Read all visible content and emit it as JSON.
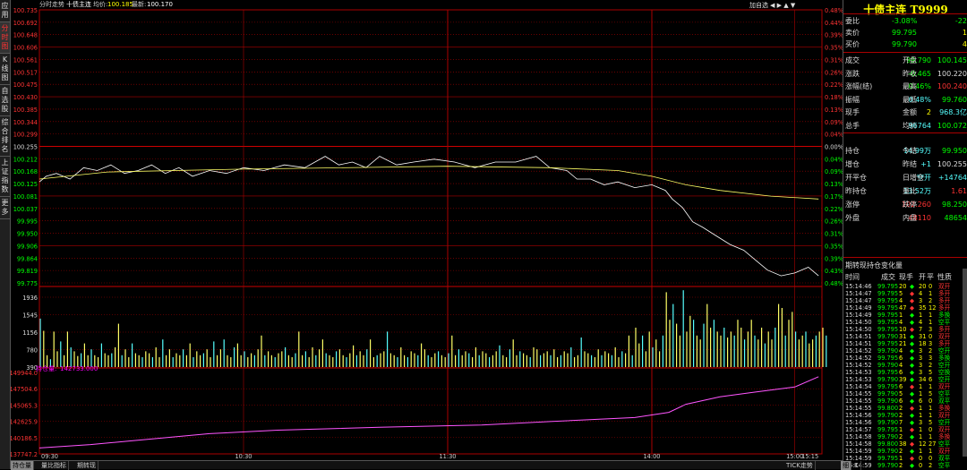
{
  "tabs": [
    "应用",
    "分时图",
    "K线图",
    "自选股",
    "综合排名",
    "上证指数",
    "更多"
  ],
  "header": {
    "title": "分时走势",
    "instrument": "十债主连",
    "avg_label": "均价:",
    "avg": "100.185",
    "last_label": "最新:",
    "last": "100.170",
    "add_self": "加自选"
  },
  "axis": {
    "price": [
      "100.735",
      "100.692",
      "100.648",
      "100.606",
      "100.561",
      "100.517",
      "100.475",
      "100.430",
      "100.385",
      "100.344",
      "100.299",
      "100.255",
      "100.212",
      "100.168",
      "100.125",
      "100.081",
      "100.037",
      "99.995",
      "99.950",
      "99.906",
      "99.864",
      "99.819",
      "99.775"
    ],
    "pct": [
      "0.48%",
      "0.44%",
      "0.39%",
      "0.35%",
      "0.31%",
      "0.26%",
      "0.22%",
      "0.18%",
      "0.13%",
      "0.09%",
      "0.04%",
      "0.00%",
      "0.04%",
      "0.09%",
      "0.13%",
      "0.17%",
      "0.22%",
      "0.26%",
      "0.31%",
      "0.35%",
      "0.39%",
      "0.43%",
      "0.48%"
    ],
    "vol": [
      "1936",
      "1545",
      "1156",
      "780",
      "390"
    ],
    "oi": [
      "149944.0",
      "147504.6",
      "145065.3",
      "142625.9",
      "140186.5",
      "137747.2"
    ],
    "time": [
      "09:30",
      "10:30",
      "11:30",
      "14:00",
      "15:00",
      "15:15"
    ]
  },
  "oi_label": "持仓量:",
  "oi_value": "142733.000",
  "chart_data": {
    "type": "line",
    "x_start": "09:30",
    "x_end": "15:15",
    "prev_close": 100.255,
    "ylim": [
      99.775,
      100.735
    ],
    "price_points": [
      [
        0,
        100.13
      ],
      [
        2,
        100.15
      ],
      [
        5,
        100.16
      ],
      [
        9,
        100.14
      ],
      [
        13,
        100.18
      ],
      [
        17,
        100.17
      ],
      [
        21,
        100.19
      ],
      [
        25,
        100.16
      ],
      [
        29,
        100.17
      ],
      [
        33,
        100.19
      ],
      [
        37,
        100.16
      ],
      [
        41,
        100.18
      ],
      [
        45,
        100.15
      ],
      [
        50,
        100.17
      ],
      [
        55,
        100.16
      ],
      [
        60,
        100.18
      ],
      [
        66,
        100.17
      ],
      [
        72,
        100.19
      ],
      [
        78,
        100.18
      ],
      [
        84,
        100.22
      ],
      [
        88,
        100.19
      ],
      [
        92,
        100.2
      ],
      [
        96,
        100.18
      ],
      [
        100,
        100.22
      ],
      [
        105,
        100.19
      ],
      [
        110,
        100.2
      ],
      [
        116,
        100.21
      ],
      [
        122,
        100.2
      ],
      [
        128,
        100.18
      ],
      [
        134,
        100.2
      ],
      [
        140,
        100.2
      ],
      [
        146,
        100.22
      ],
      [
        150,
        100.18
      ],
      [
        155,
        100.17
      ],
      [
        158,
        100.14
      ],
      [
        162,
        100.14
      ],
      [
        166,
        100.12
      ],
      [
        170,
        100.13
      ],
      [
        175,
        100.11
      ],
      [
        180,
        100.12
      ],
      [
        184,
        100.1
      ],
      [
        186,
        100.07
      ],
      [
        189,
        100.04
      ],
      [
        192,
        99.99
      ],
      [
        195,
        99.97
      ],
      [
        199,
        99.94
      ],
      [
        203,
        99.91
      ],
      [
        207,
        99.89
      ],
      [
        211,
        99.85
      ],
      [
        214,
        99.82
      ],
      [
        218,
        99.8
      ],
      [
        222,
        99.81
      ],
      [
        226,
        99.83
      ],
      [
        229,
        99.8
      ]
    ],
    "avg_points": [
      [
        0,
        100.14
      ],
      [
        20,
        100.165
      ],
      [
        60,
        100.175
      ],
      [
        120,
        100.185
      ],
      [
        150,
        100.18
      ],
      [
        170,
        100.17
      ],
      [
        180,
        100.15
      ],
      [
        190,
        100.12
      ],
      [
        200,
        100.1
      ],
      [
        215,
        100.08
      ],
      [
        229,
        100.07
      ]
    ],
    "volume": [
      1230,
      920,
      300,
      200,
      900,
      400,
      650,
      300,
      900,
      500,
      400,
      280,
      350,
      600,
      300,
      450,
      300,
      250,
      600,
      350,
      300,
      350,
      500,
      1100,
      300,
      450,
      250,
      600,
      350,
      300,
      250,
      400,
      350,
      250,
      500,
      250,
      700,
      300,
      450,
      250,
      350,
      300,
      450,
      300,
      600,
      250,
      400,
      300,
      350,
      450,
      250,
      650,
      300,
      450,
      700,
      300,
      250,
      500,
      600,
      300,
      400,
      250,
      350,
      300,
      450,
      800,
      300,
      400,
      300,
      250,
      350,
      400,
      500,
      300,
      250,
      350,
      900,
      300,
      400,
      250,
      500,
      300,
      450,
      700,
      350,
      300,
      250,
      400,
      450,
      300,
      250,
      350,
      550,
      300,
      400,
      300,
      450,
      700,
      250,
      300,
      350,
      400,
      900,
      350,
      300,
      250,
      500,
      300,
      250,
      400,
      350,
      300,
      600,
      450,
      300,
      250,
      350,
      400,
      300,
      250,
      350,
      800,
      300,
      450,
      300,
      400,
      350,
      250,
      500,
      300,
      400,
      350,
      250,
      300,
      400,
      550,
      300,
      250,
      450,
      700,
      300,
      400,
      350,
      300,
      250,
      500,
      450,
      300,
      350,
      400,
      300,
      450,
      250,
      300,
      400,
      350,
      500,
      250,
      300,
      750,
      400,
      350,
      300,
      250,
      450,
      300,
      400,
      350,
      300,
      500,
      250,
      400,
      350,
      800,
      300,
      1000,
      600,
      800,
      400,
      900,
      500,
      700,
      400,
      800,
      1900,
      1200,
      1600,
      1100,
      800,
      1950,
      900,
      1300,
      1200,
      800,
      700,
      1100,
      1600,
      1000,
      1200,
      900,
      800,
      1000,
      750,
      900,
      800,
      1200,
      1000,
      700,
      900,
      1200,
      800,
      700,
      1000,
      600,
      900,
      700,
      1000,
      1600,
      1500,
      800,
      1200,
      1400,
      900,
      700,
      800,
      900,
      600,
      700,
      800,
      900,
      1000,
      800
    ],
    "oi": [
      [
        0,
        136900
      ],
      [
        15,
        137500
      ],
      [
        30,
        138300
      ],
      [
        50,
        139400
      ],
      [
        70,
        140000
      ],
      [
        100,
        140500
      ],
      [
        130,
        140900
      ],
      [
        150,
        141500
      ],
      [
        175,
        142200
      ],
      [
        185,
        143100
      ],
      [
        190,
        144500
      ],
      [
        200,
        145800
      ],
      [
        210,
        146600
      ],
      [
        222,
        147500
      ],
      [
        229,
        149300
      ]
    ]
  },
  "panel": {
    "name": "十债主连",
    "code": "T9999",
    "rows": [
      {
        "l": "委比",
        "v1": "-3.08%",
        "c1": "g",
        "v2": "-22",
        "c2": "g"
      },
      {
        "l": "卖价",
        "v1": "99.795",
        "c1": "g",
        "v2": "1",
        "c2": "y"
      },
      {
        "l": "买价",
        "v1": "99.790",
        "c1": "g",
        "v2": "4",
        "c2": "y"
      }
    ],
    "quote": [
      {
        "l": "成交",
        "v1": "99.790",
        "c1": "g",
        "m": "开盘",
        "v2": "100.145",
        "c2": "g"
      },
      {
        "l": "涨跌",
        "v1": "-0.465",
        "c1": "g",
        "m": "昨收",
        "v2": "100.220",
        "c2": "w"
      },
      {
        "l": "涨幅(结)",
        "v1": "-0.46%",
        "c1": "g",
        "m": "最高",
        "v2": "100.240",
        "c2": "r"
      },
      {
        "l": "振幅",
        "v1": "0.48%",
        "c1": "c",
        "m": "最低",
        "v2": "99.760",
        "c2": "g"
      },
      {
        "l": "现手",
        "v1": "2",
        "c1": "y",
        "m": "金额",
        "v2": "968.3亿",
        "c2": "c"
      },
      {
        "l": "总手",
        "v1": "96764",
        "c1": "c",
        "m": "均价",
        "v2": "100.072",
        "c2": "g"
      }
    ],
    "quote2": [
      {
        "l": "持仓",
        "v1": "14.99万",
        "c1": "c",
        "m": "今结",
        "v2": "99.950",
        "c2": "g"
      },
      {
        "l": "增仓",
        "v1": "+1",
        "c1": "c",
        "m": "昨结",
        "v2": "100.255",
        "c2": "w"
      },
      {
        "l": "开平仓",
        "v1": "空开",
        "c1": "c",
        "m": "日增仓",
        "v2": "+14764",
        "c2": "c"
      },
      {
        "l": "昨持仓",
        "v1": "13.52万",
        "c1": "c",
        "m": "量比",
        "v2": "1.61",
        "c2": "r"
      },
      {
        "l": "涨停",
        "v1": "102.260",
        "c1": "r",
        "m": "跌停",
        "v2": "98.250",
        "c2": "g"
      },
      {
        "l": "外盘",
        "v1": "48110",
        "c1": "r",
        "m": "内盘",
        "v2": "48654",
        "c2": "g"
      }
    ],
    "ticks_title": "期转现持仓变化量",
    "tick_headers": [
      "时间",
      "成交",
      "现手",
      "开",
      "平",
      "性质"
    ],
    "ticks": [
      [
        "15:14:46",
        "99.795",
        "20",
        "g",
        "20",
        "0",
        "双开",
        "r"
      ],
      [
        "15:14:47",
        "99.795",
        "5",
        "r",
        "4",
        "1",
        "多开",
        "r"
      ],
      [
        "15:14:47",
        "99.795",
        "4",
        "r",
        "3",
        "2",
        "多开",
        "r"
      ],
      [
        "15:14:49",
        "99.795",
        "47",
        "r",
        "35",
        "12",
        "多开",
        "r"
      ],
      [
        "15:14:49",
        "99.795",
        "1",
        "g",
        "1",
        "1",
        "多换",
        "g"
      ],
      [
        "15:14:50",
        "99.795",
        "4",
        "g",
        "4",
        "1",
        "空平",
        "g"
      ],
      [
        "15:14:50",
        "99.795",
        "10",
        "r",
        "7",
        "3",
        "多开",
        "r"
      ],
      [
        "15:14:51",
        "99.790",
        "31",
        "g",
        "31",
        "0",
        "双开",
        "r"
      ],
      [
        "15:14:51",
        "99.795",
        "21",
        "g",
        "18",
        "3",
        "多开",
        "r"
      ],
      [
        "15:14:52",
        "99.790",
        "4",
        "g",
        "3",
        "2",
        "空开",
        "g"
      ],
      [
        "15:14:52",
        "99.795",
        "6",
        "g",
        "3",
        "3",
        "多换",
        "g"
      ],
      [
        "15:14:52",
        "99.790",
        "4",
        "g",
        "3",
        "2",
        "空开",
        "g"
      ],
      [
        "15:14:53",
        "99.795",
        "6",
        "g",
        "3",
        "5",
        "空换",
        "g"
      ],
      [
        "15:14:53",
        "99.790",
        "39",
        "g",
        "34",
        "6",
        "空开",
        "g"
      ],
      [
        "15:14:54",
        "99.795",
        "6",
        "r",
        "1",
        "1",
        "双开",
        "r"
      ],
      [
        "15:14:55",
        "99.790",
        "5",
        "g",
        "1",
        "5",
        "空平",
        "g"
      ],
      [
        "15:14:55",
        "99.790",
        "6",
        "g",
        "6",
        "0",
        "双平",
        "g"
      ],
      [
        "15:14:55",
        "99.800",
        "2",
        "r",
        "1",
        "1",
        "多换",
        "r"
      ],
      [
        "15:14:56",
        "99.790",
        "2",
        "g",
        "1",
        "1",
        "双开",
        "r"
      ],
      [
        "15:14:56",
        "99.790",
        "7",
        "g",
        "3",
        "5",
        "空开",
        "g"
      ],
      [
        "15:14:57",
        "99.795",
        "1",
        "r",
        "1",
        "0",
        "双开",
        "r"
      ],
      [
        "15:14:58",
        "99.790",
        "2",
        "g",
        "1",
        "1",
        "多换",
        "r"
      ],
      [
        "15:14:58",
        "99.800",
        "38",
        "r",
        "12",
        "27",
        "空平",
        "g"
      ],
      [
        "15:14:59",
        "99.790",
        "2",
        "g",
        "1",
        "1",
        "双开",
        "r"
      ],
      [
        "15:14:59",
        "99.795",
        "1",
        "r",
        "0",
        "0",
        "双平",
        "g"
      ],
      [
        "15:14:59",
        "99.790",
        "2",
        "g",
        "0",
        "2",
        "空平",
        "g"
      ]
    ]
  },
  "bottom": {
    "tabs": [
      "持仓量",
      "量比指标",
      "期转现"
    ],
    "right": [
      "TICK走势",
      "细",
      "K"
    ]
  }
}
